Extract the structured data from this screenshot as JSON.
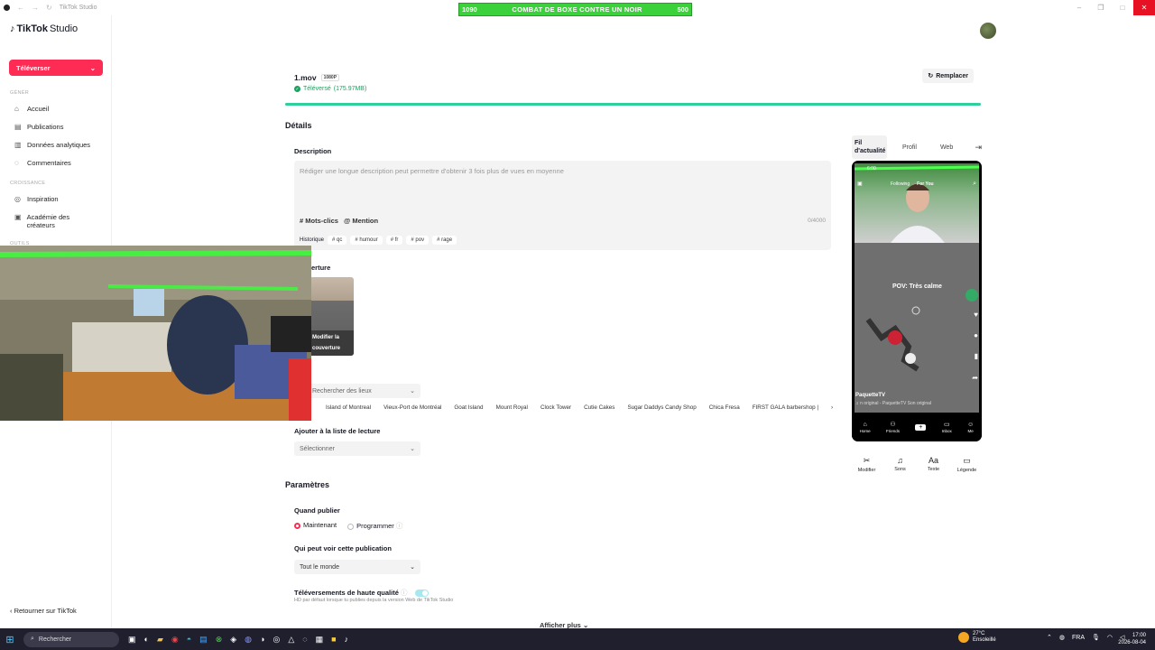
{
  "window": {
    "title": "TikTok Studio"
  },
  "overlay": {
    "left": "1090",
    "title": "COMBAT DE BOXE CONTRE UN NOIR",
    "right": "500"
  },
  "sidebar": {
    "logo": {
      "brand": "TikTok",
      "sub": "Studio"
    },
    "upload_label": "Téléverser",
    "sections": {
      "general": "GÉNÉR",
      "growth": "CROISSANCE",
      "tools": "OUTILS"
    },
    "items": [
      {
        "label": "Accueil",
        "icon": "home-icon"
      },
      {
        "label": "Publications",
        "icon": "posts-icon"
      },
      {
        "label": "Données analytiques",
        "icon": "analytics-icon"
      },
      {
        "label": "Commentaires",
        "icon": "comments-icon"
      },
      {
        "label": "Inspiration",
        "icon": "inspiration-icon"
      },
      {
        "label": "Académie des créateurs",
        "icon": "academy-icon"
      }
    ],
    "back_link": "Retourner sur TikTok"
  },
  "file": {
    "name": "1.mov",
    "badge": "1080P",
    "status": "Téléversé",
    "size": "(175.97MB)",
    "replace": "Remplacer",
    "progress": 1.0
  },
  "details": {
    "section_title": "Détails",
    "description_label": "Description",
    "description_placeholder": "Rédiger une longue description peut permettre d'obtenir 3 fois plus de vues en moyenne",
    "hashtags_btn": "# Mots-clics",
    "mention_btn": "@ Mention",
    "char_count": "0/4000",
    "history_label": "Historique",
    "history_chips": [
      "# qc",
      "# humour",
      "# fr",
      "# pov",
      "# rage"
    ],
    "cover_label": "erture",
    "cover_edit_line1": "Modifier la",
    "cover_edit_line2": "couverture",
    "location_placeholder": "Rechercher des lieux",
    "locations": [
      "Island of Montreal",
      "Vieux-Port de Montréal",
      "Goat Island",
      "Mount Royal",
      "Clock Tower",
      "Cutie Cakes",
      "Sugar Daddys Candy Shop",
      "Chica Fresa",
      "FIRST GALA barbershop |"
    ],
    "playlist_label": "Ajouter à la liste de lecture",
    "playlist_placeholder": "Sélectionner"
  },
  "settings": {
    "section_title": "Paramètres",
    "when_label": "Quand publier",
    "opt_now": "Maintenant",
    "opt_schedule": "Programmer",
    "who_label": "Qui peut voir cette publication",
    "who_value": "Tout le monde",
    "hq_label": "Téléversements de haute qualité",
    "hq_note": "HD par défaut lorsque tu publies depuis la version Web de TikTok Studio",
    "hq_enabled": true,
    "show_more": "Afficher plus"
  },
  "preview": {
    "tabs": [
      "Fil d'actualité",
      "Profil",
      "Web"
    ],
    "time": "6:00",
    "following": "Following",
    "for_you": "For You",
    "caption": "POV: Très calme",
    "username": "PaquetteTV",
    "sound": "♫ n original - PaquetteTV   Son original",
    "nav": [
      "Home",
      "Friends",
      "",
      "Inbox",
      "Me"
    ],
    "tools": [
      {
        "label": "Modifier",
        "icon": "scissors-icon"
      },
      {
        "label": "Sons",
        "icon": "music-icon"
      },
      {
        "label": "Texte",
        "icon": "text-icon"
      },
      {
        "label": "Légende",
        "icon": "caption-icon"
      }
    ]
  },
  "taskbar": {
    "search": "Rechercher",
    "weather_temp": "27°C",
    "weather_desc": "Ensoleillé",
    "lang": "FRA",
    "time": "17:00",
    "date": "2026-08-04"
  }
}
